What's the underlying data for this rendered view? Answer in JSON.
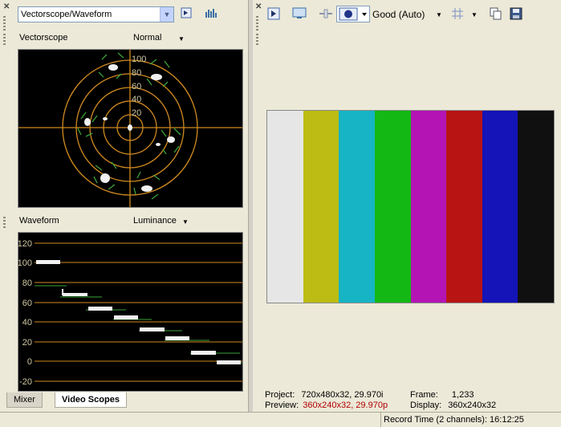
{
  "left_panel": {
    "scope_selector": {
      "value": "Vectorscope/Waveform"
    },
    "vectorscope": {
      "label": "Vectorscope",
      "mode": "Normal",
      "ring_labels": [
        "100",
        "80",
        "60",
        "40",
        "20"
      ]
    },
    "waveform": {
      "label": "Waveform",
      "mode": "Luminance",
      "scale_labels": [
        "120",
        "100",
        "80",
        "60",
        "40",
        "20",
        "0",
        "-20"
      ]
    },
    "tabs": [
      {
        "label": "Mixer",
        "active": false
      },
      {
        "label": "Video Scopes",
        "active": true
      }
    ]
  },
  "right_panel": {
    "toolbar": {
      "quality": "Good (Auto)"
    },
    "color_bars": [
      "#e6e6e6",
      "#bcbc14",
      "#16b4c4",
      "#14b814",
      "#b414b4",
      "#b81414",
      "#1414b8",
      "#101010"
    ],
    "info": {
      "project_label": "Project:",
      "project_value": "720x480x32, 29.970i",
      "preview_label": "Preview:",
      "preview_value": "360x240x32, 29.970p",
      "frame_label": "Frame:",
      "frame_value": "1,233",
      "display_label": "Display:",
      "display_value": "360x240x32"
    }
  },
  "statusbar": {
    "record_time": "Record Time (2 channels): 16:12:25"
  },
  "colors": {
    "scope_graticule": "#d08a20",
    "scope_target": "#3aa33a",
    "preview_red": "#b00000"
  }
}
